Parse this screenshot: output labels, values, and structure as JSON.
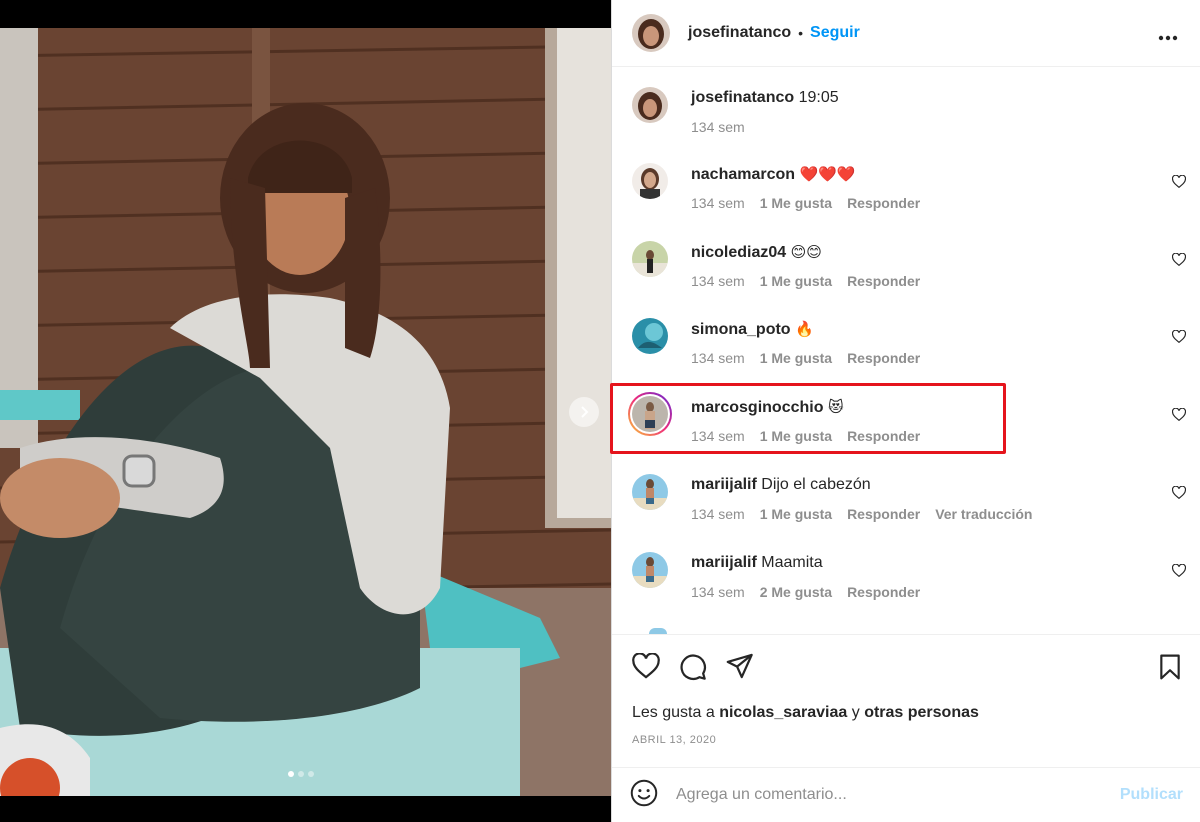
{
  "post": {
    "slide_count": 3,
    "active_slide": 1
  },
  "header": {
    "username": "josefinatanco",
    "separator": "•",
    "follow_label": "Seguir",
    "more_icon": "more-options-icon"
  },
  "caption": {
    "username": "josefinatanco",
    "text": "19:05",
    "time": "134 sem"
  },
  "comments": [
    {
      "username": "nachamarcon",
      "text": "❤️❤️❤️",
      "time": "134 sem",
      "likes": "1 Me gusta",
      "reply": "Responder",
      "translate": ""
    },
    {
      "username": "nicolediaz04",
      "text": "😊😊",
      "time": "134 sem",
      "likes": "1 Me gusta",
      "reply": "Responder",
      "translate": ""
    },
    {
      "username": "simona_poto",
      "text": "🔥",
      "time": "134 sem",
      "likes": "1 Me gusta",
      "reply": "Responder",
      "translate": ""
    },
    {
      "username": "marcosginocchio",
      "text": "😻",
      "time": "134 sem",
      "likes": "1 Me gusta",
      "reply": "Responder",
      "translate": ""
    },
    {
      "username": "mariijalif",
      "text": "Dijo el cabezón",
      "time": "134 sem",
      "likes": "1 Me gusta",
      "reply": "Responder",
      "translate": "Ver traducción"
    },
    {
      "username": "mariijalif",
      "text": "Maamita",
      "time": "134 sem",
      "likes": "2 Me gusta",
      "reply": "Responder",
      "translate": ""
    }
  ],
  "likes_line": {
    "prefix": "Les gusta a",
    "user": "nicolas_saraviaa",
    "joiner": "y",
    "others": "otras personas"
  },
  "date": "ABRIL 13, 2020",
  "composer": {
    "placeholder": "Agrega un comentario...",
    "publish_label": "Publicar"
  },
  "colors": {
    "accent": "#0095f6",
    "highlight": "#e5141c",
    "muted": "#8e8e8e"
  }
}
